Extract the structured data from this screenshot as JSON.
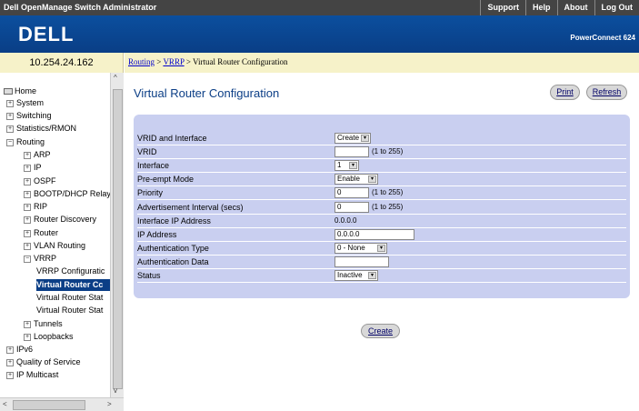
{
  "topbar": {
    "title": "Dell OpenManage Switch Administrator",
    "links": [
      "Support",
      "Help",
      "About",
      "Log Out"
    ]
  },
  "banner": {
    "logo": "DELL",
    "product": "PowerConnect 624"
  },
  "ip_address": "10.254.24.162",
  "breadcrumb": {
    "part1": "Routing",
    "sep1": " > ",
    "part2": "VRRP",
    "sep2": " > ",
    "current": "Virtual Router Configuration"
  },
  "nav": [
    {
      "label": "Home",
      "icon": "home-icon"
    },
    {
      "label": "System",
      "icon": "expand"
    },
    {
      "label": "Switching",
      "icon": "expand"
    },
    {
      "label": "Statistics/RMON",
      "icon": "expand"
    },
    {
      "label": "Routing",
      "icon": "collapse"
    },
    {
      "label": "ARP",
      "icon": "expand"
    },
    {
      "label": "IP",
      "icon": "expand"
    },
    {
      "label": "OSPF",
      "icon": "expand"
    },
    {
      "label": "BOOTP/DHCP Relay",
      "icon": "expand"
    },
    {
      "label": "RIP",
      "icon": "expand"
    },
    {
      "label": "Router Discovery",
      "icon": "expand"
    },
    {
      "label": "Router",
      "icon": "expand"
    },
    {
      "label": "VLAN Routing",
      "icon": "expand"
    },
    {
      "label": "VRRP",
      "icon": "collapse"
    },
    {
      "label": "VRRP Configuratic",
      "icon": "none"
    },
    {
      "label": "Virtual Router Cc",
      "icon": "none",
      "selected": true
    },
    {
      "label": "Virtual Router Stat",
      "icon": "none"
    },
    {
      "label": "Virtual Router Stat",
      "icon": "none"
    },
    {
      "label": "Tunnels",
      "icon": "expand"
    },
    {
      "label": "Loopbacks",
      "icon": "expand"
    },
    {
      "label": "IPv6",
      "icon": "expand"
    },
    {
      "label": "Quality of Service",
      "icon": "expand"
    },
    {
      "label": "IP Multicast",
      "icon": "expand"
    }
  ],
  "page": {
    "title": "Virtual Router Configuration",
    "print_label": "Print",
    "refresh_label": "Refresh",
    "create_label": "Create"
  },
  "form": [
    {
      "label": "VRID and Interface",
      "type": "select",
      "value": "Create"
    },
    {
      "label": "VRID",
      "type": "text",
      "value": "",
      "hint": "(1 to 255)"
    },
    {
      "label": "Interface",
      "type": "select",
      "value": "1"
    },
    {
      "label": "Pre-empt Mode",
      "type": "select",
      "value": "Enable"
    },
    {
      "label": "Priority",
      "type": "text",
      "value": "0",
      "hint": "(1 to 255)"
    },
    {
      "label": "Advertisement Interval (secs)",
      "type": "text",
      "value": "0",
      "hint": "(1 to 255)"
    },
    {
      "label": "Interface IP Address",
      "type": "static",
      "value": "0.0.0.0"
    },
    {
      "label": "IP Address",
      "type": "text",
      "value": "0.0.0.0"
    },
    {
      "label": "Authentication Type",
      "type": "select",
      "value": "0 - None"
    },
    {
      "label": "Authentication Data",
      "type": "text",
      "value": ""
    },
    {
      "label": "Status",
      "type": "select",
      "value": "Inactive"
    }
  ],
  "colors": {
    "topbar": "#444444",
    "banner": "#0b4f9e",
    "panel": "#c9cff0",
    "title": "#0b3e86",
    "selected": "#0b3e86"
  }
}
